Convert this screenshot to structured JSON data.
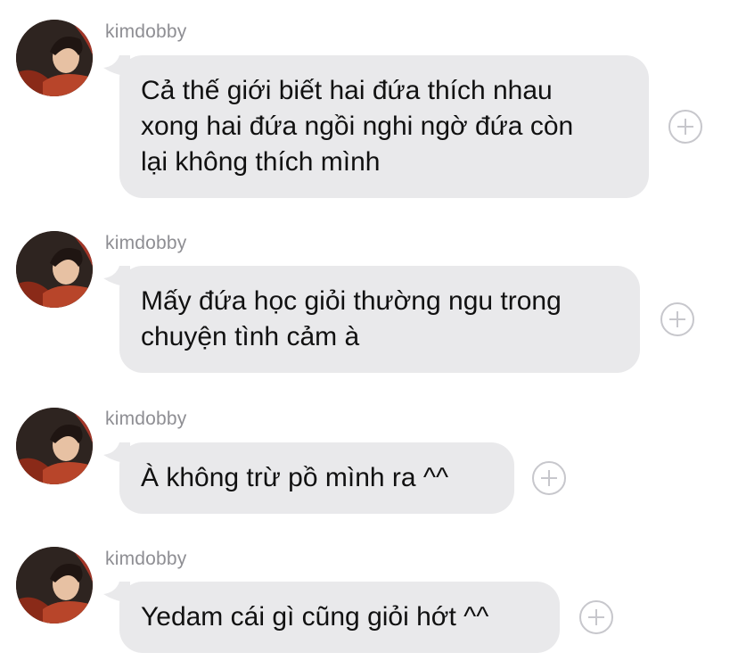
{
  "messages": [
    {
      "sender": "kimdobby",
      "text": "Cả thế giới biết hai đứa thích nhau xong hai đứa ngồi nghi ngờ đứa còn lại không thích mình",
      "lines": [
        "Cả thế giới biết hai đứa thích nhau",
        "xong hai đứa ngồi nghi ngờ đứa còn",
        "lại không thích mình"
      ]
    },
    {
      "sender": "kimdobby",
      "text": "Mấy đứa học giỏi thường ngu trong chuyện tình cảm à",
      "lines": [
        "Mấy đứa học giỏi thường ngu trong",
        "chuyện tình cảm à"
      ]
    },
    {
      "sender": "kimdobby",
      "text": "À không trừ pồ mình ra ^^",
      "lines": [
        "À không trừ pồ mình ra ^^"
      ]
    },
    {
      "sender": "kimdobby",
      "text": "Yedam cái gì cũng giỏi hớt ^^",
      "lines": [
        "Yedam cái gì cũng giỏi hớt ^^"
      ]
    }
  ],
  "icons": {
    "avatar": "profile-photo",
    "reaction": "add-reaction-plus-icon"
  },
  "colors": {
    "bubble": "#e9e9eb",
    "sender": "#8e8e93",
    "text": "#111111",
    "reaction": "#c7c7cc"
  }
}
